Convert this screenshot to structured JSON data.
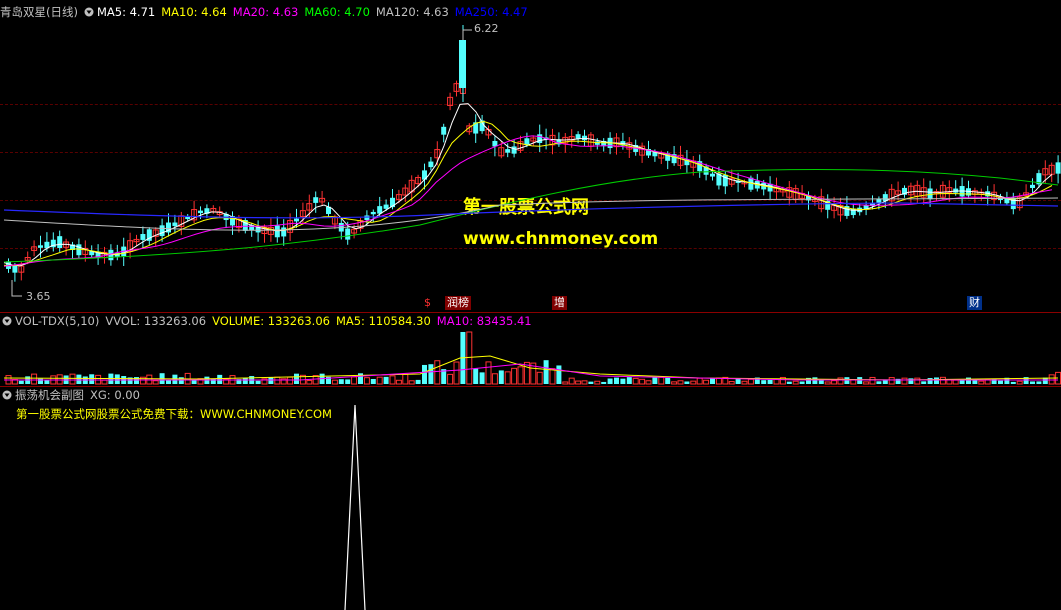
{
  "main_header": {
    "stock_name": "青岛双星(日线)",
    "indicators": [
      {
        "label": "MA5: 4.71",
        "color": "#ffffff"
      },
      {
        "label": "MA10: 4.64",
        "color": "#ffff00"
      },
      {
        "label": "MA20: 4.63",
        "color": "#ff00ff"
      },
      {
        "label": "MA60: 4.70",
        "color": "#00ff00"
      },
      {
        "label": "MA120: 4.63",
        "color": "#c0c0c0"
      },
      {
        "label": "MA250: 4.47",
        "color": "#0000ff"
      }
    ]
  },
  "price_labels": {
    "high": "6.22",
    "low": "3.65"
  },
  "watermark": {
    "line1": "第一股票公式网",
    "line2": "www.chnmoney.com"
  },
  "events": [
    {
      "text": "$",
      "color": "#ff3030"
    },
    {
      "text": "润榜",
      "color": "#ffffff"
    },
    {
      "text": "增",
      "color": "#ffffff"
    },
    {
      "text": "财",
      "color": "#ffffff"
    }
  ],
  "volume_header": {
    "name": "VOL-TDX(5,10)",
    "items": [
      {
        "label": "VVOL: 133263.06",
        "color": "#c0c0c0"
      },
      {
        "label": "VOLUME: 133263.06",
        "color": "#ffff00"
      },
      {
        "label": "MA5: 110584.30",
        "color": "#ffff00"
      },
      {
        "label": "MA10: 83435.41",
        "color": "#ff00ff"
      }
    ]
  },
  "sub_header": {
    "name": "振荡机会副图",
    "value": "XG: 0.00"
  },
  "promo_text": "第一股票公式网股票公式免费下载：WWW.CHNMONEY.COM",
  "colors": {
    "up": "#ff3232",
    "down": "#54ffff",
    "background": "#000000",
    "separator": "#8b0000"
  }
}
